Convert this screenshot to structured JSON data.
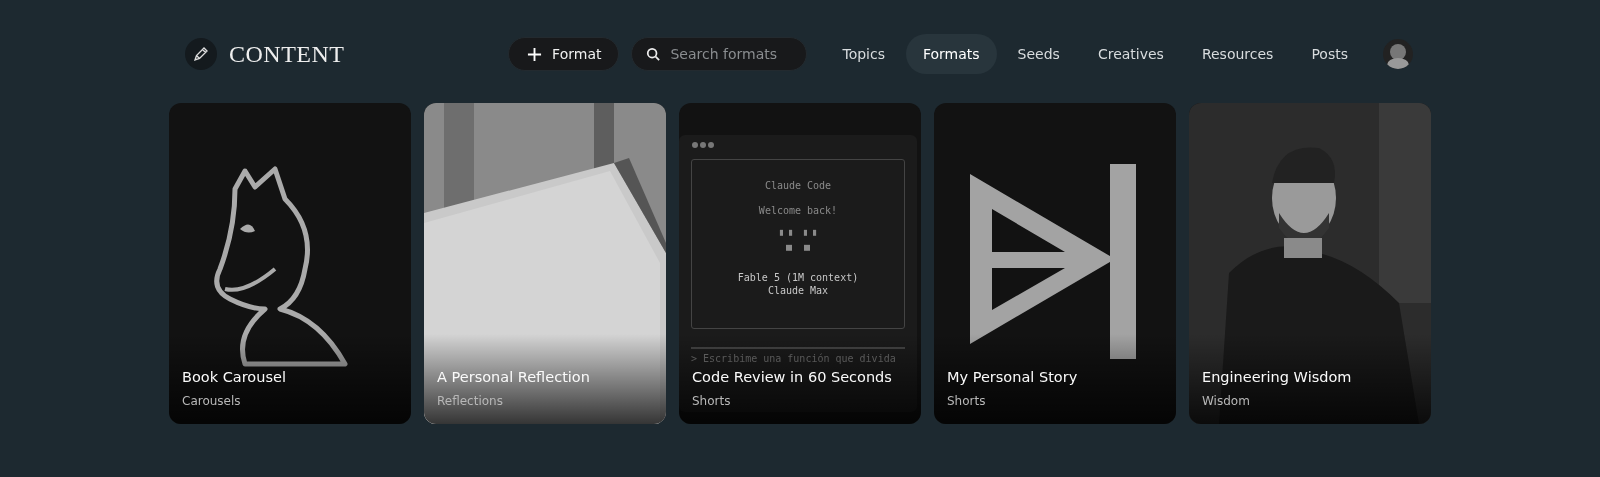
{
  "brand": {
    "title": "CONTENT"
  },
  "add_button": {
    "label": "Format"
  },
  "search": {
    "placeholder": "Search formats"
  },
  "nav": [
    {
      "label": "Topics",
      "selected": false
    },
    {
      "label": "Formats",
      "selected": true
    },
    {
      "label": "Seeds",
      "selected": false
    },
    {
      "label": "Creatives",
      "selected": false
    },
    {
      "label": "Resources",
      "selected": false
    },
    {
      "label": "Posts",
      "selected": false
    }
  ],
  "cards": [
    {
      "title": "Book Carousel",
      "subtitle": "Carousels",
      "thumbnail": {
        "kind": "knight"
      }
    },
    {
      "title": "A Personal Reflection",
      "subtitle": "Reflections"
    },
    {
      "title": "Code Review in 60 Seconds",
      "subtitle": "Shorts",
      "thumbnail": {
        "kind": "terminal",
        "heading": "Claude Code",
        "greeting": "Welcome back!",
        "art": [
          "▘▝  ▘▝",
          "▝▘ ▝▘"
        ],
        "model": "Fable 5 (1M context)",
        "plan": "Claude Max",
        "prompt": "> Escribime una función que divida"
      }
    },
    {
      "title": "My Personal Story",
      "subtitle": "Shorts",
      "thumbnail": {
        "kind": "mark"
      }
    },
    {
      "title": "Engineering Wisdom",
      "subtitle": "Wisdom",
      "thumbnail": {
        "kind": "portrait"
      }
    }
  ]
}
